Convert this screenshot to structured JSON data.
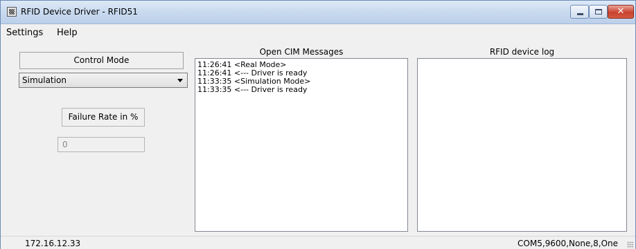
{
  "window": {
    "title": "RFID Device Driver - RFID51"
  },
  "title_buttons": {
    "close_label": "✕"
  },
  "menu": {
    "items": [
      "Settings",
      "Help"
    ]
  },
  "control": {
    "header": "Control Mode",
    "mode_value": "Simulation",
    "failure_label": "Failure Rate in %",
    "failure_value": "0"
  },
  "panels": {
    "cim_title": "Open CIM Messages",
    "log_title": "RFID device log",
    "cim_messages": [
      "11:26:41 <Real Mode>",
      "11:26:41 <--- Driver is ready",
      "11:33:35 <Simulation Mode>",
      "11:33:35 <--- Driver is ready"
    ]
  },
  "status": {
    "ip": "172.16.12.33",
    "port": "COM5,9600,None,8,One"
  }
}
